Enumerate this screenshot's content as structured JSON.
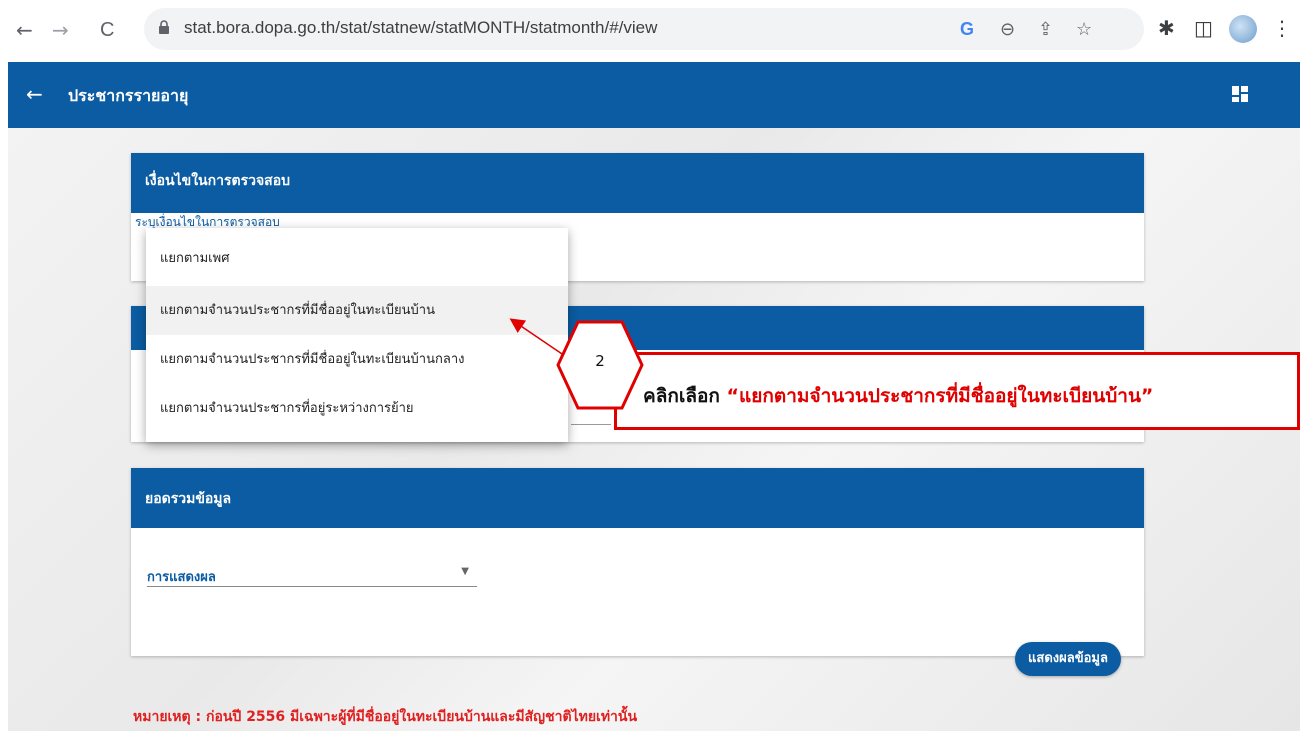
{
  "browser": {
    "back_icon": "←",
    "forward_icon": "→",
    "reload_icon": "C",
    "url": "stat.bora.dopa.go.th/stat/statnew/statMONTH/statmonth/#/view",
    "icons": {
      "google": "G",
      "zoom": "⊖",
      "share": "⇪",
      "star": "☆",
      "extensions": "✱",
      "sidepanel": "◫",
      "menu": "⋮"
    }
  },
  "app": {
    "back_icon": "←",
    "title": "ประชากรรายอายุ"
  },
  "card_conditions": {
    "header": "เงื่อนไขในการตรวจสอบ",
    "subtitle": "ระบุเงื่อนไขในการตรวจสอบ"
  },
  "dropdown": {
    "items": [
      "แยกตามเพศ",
      "แยกตามจำนวนประชากรที่มีชื่ออยู่ในทะเบียนบ้าน",
      "แยกตามจำนวนประชากรที่มีชื่ออยู่ในทะเบียนบ้านกลาง",
      "แยกตามจำนวนประชากรที่อยู่ระหว่างการย้าย"
    ],
    "highlighted_index": 1
  },
  "card_summary": {
    "header": "ยอดรวมข้อมูล",
    "select_label": "การแสดงผล",
    "caret": "▼",
    "button_label": "แสดงผลข้อมูล"
  },
  "note": "หมายเหตุ : ก่อนปี 2556 มีเฉพาะผู้ที่มีชื่ออยู่ในทะเบียนบ้านและมีสัญชาติไทยเท่านั้น",
  "annotation": {
    "step": "2",
    "prefix": "คลิกเลือก",
    "quoted": "“แยกตามจำนวนประชากรที่มีชื่ออยู่ในทะเบียนบ้าน”"
  },
  "colors": {
    "primary": "#0b5ca3",
    "annotation_red": "#e00000",
    "note_red": "#e02020"
  }
}
